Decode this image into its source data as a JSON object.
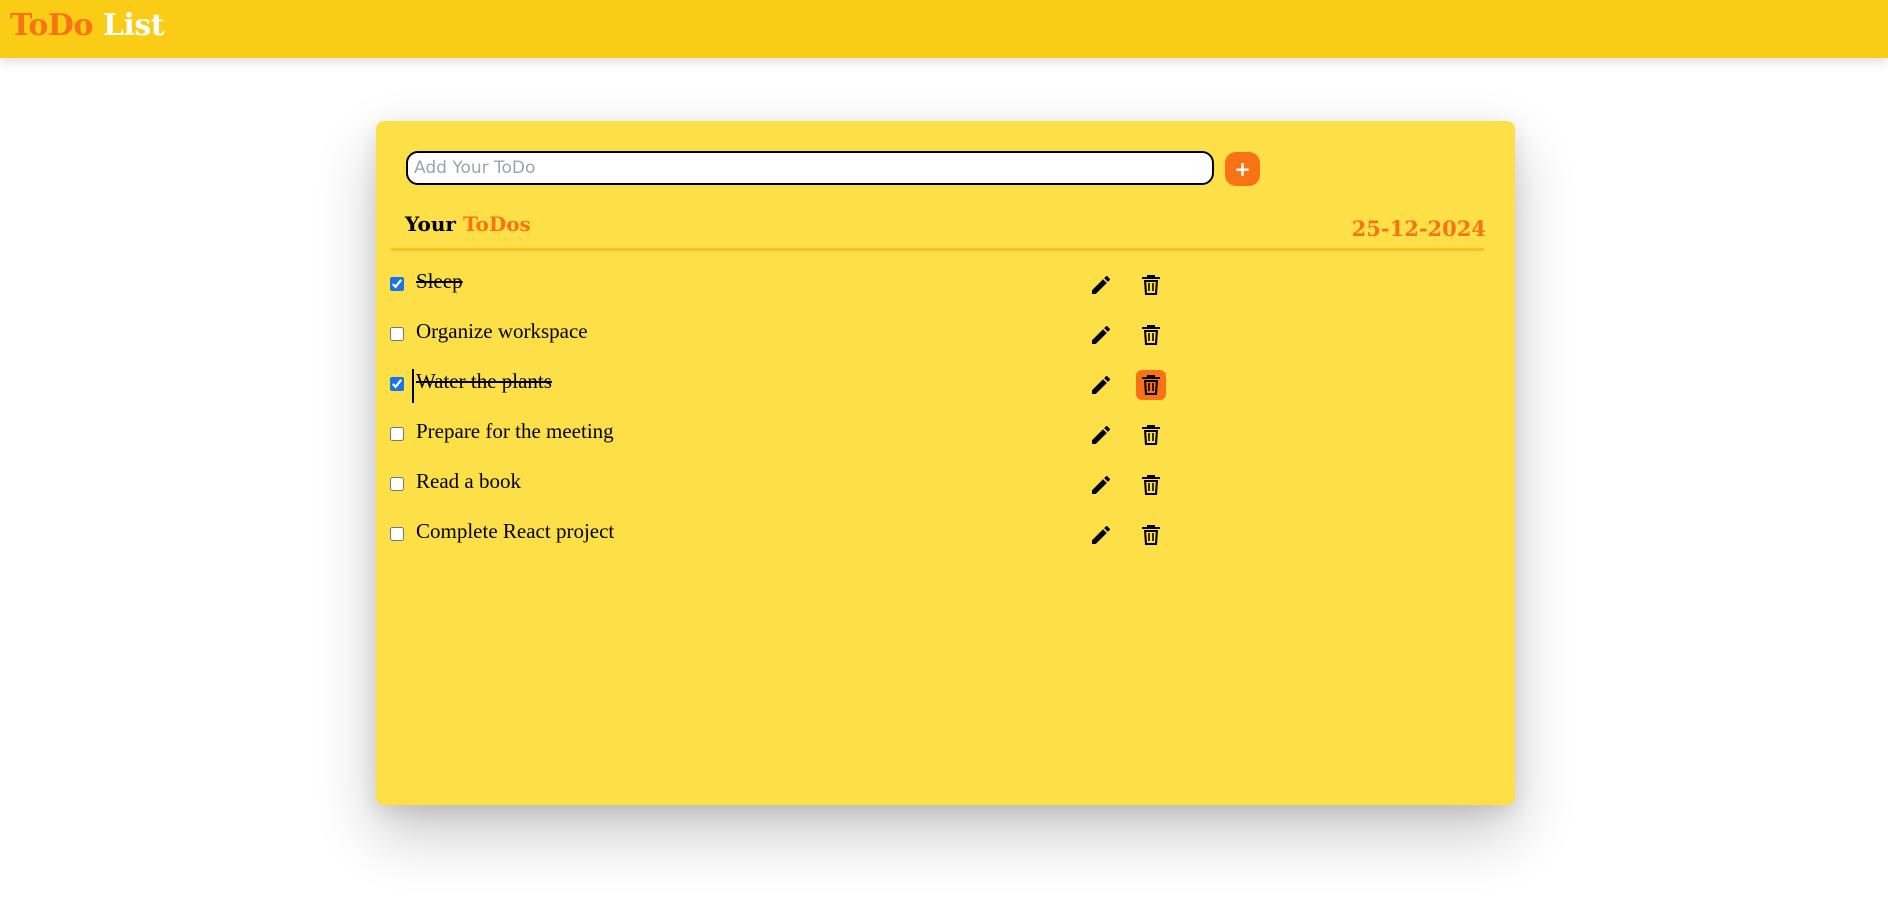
{
  "app": {
    "title_part1": "ToDo",
    "title_part2": "List"
  },
  "add_form": {
    "input_placeholder": "Add Your ToDo",
    "input_value": "",
    "add_button_label": "+"
  },
  "list": {
    "heading_part1": "Your",
    "heading_part2": "ToDos",
    "date": "25-12-2024",
    "items": [
      {
        "text": "Sleep",
        "completed": true
      },
      {
        "text": "Organize workspace",
        "completed": false
      },
      {
        "text": "Water the plants",
        "completed": true
      },
      {
        "text": "Prepare for the meeting",
        "completed": false
      },
      {
        "text": "Read a book",
        "completed": false
      },
      {
        "text": "Complete React project",
        "completed": false
      }
    ]
  },
  "icons": {
    "edit": "pencil-icon",
    "delete": "trash-icon"
  },
  "colors": {
    "header_bg": "#facc15",
    "card_bg": "#fde047",
    "accent": "#f97316",
    "divider": "#fbbf24",
    "checkbox": "#1a73e8"
  }
}
